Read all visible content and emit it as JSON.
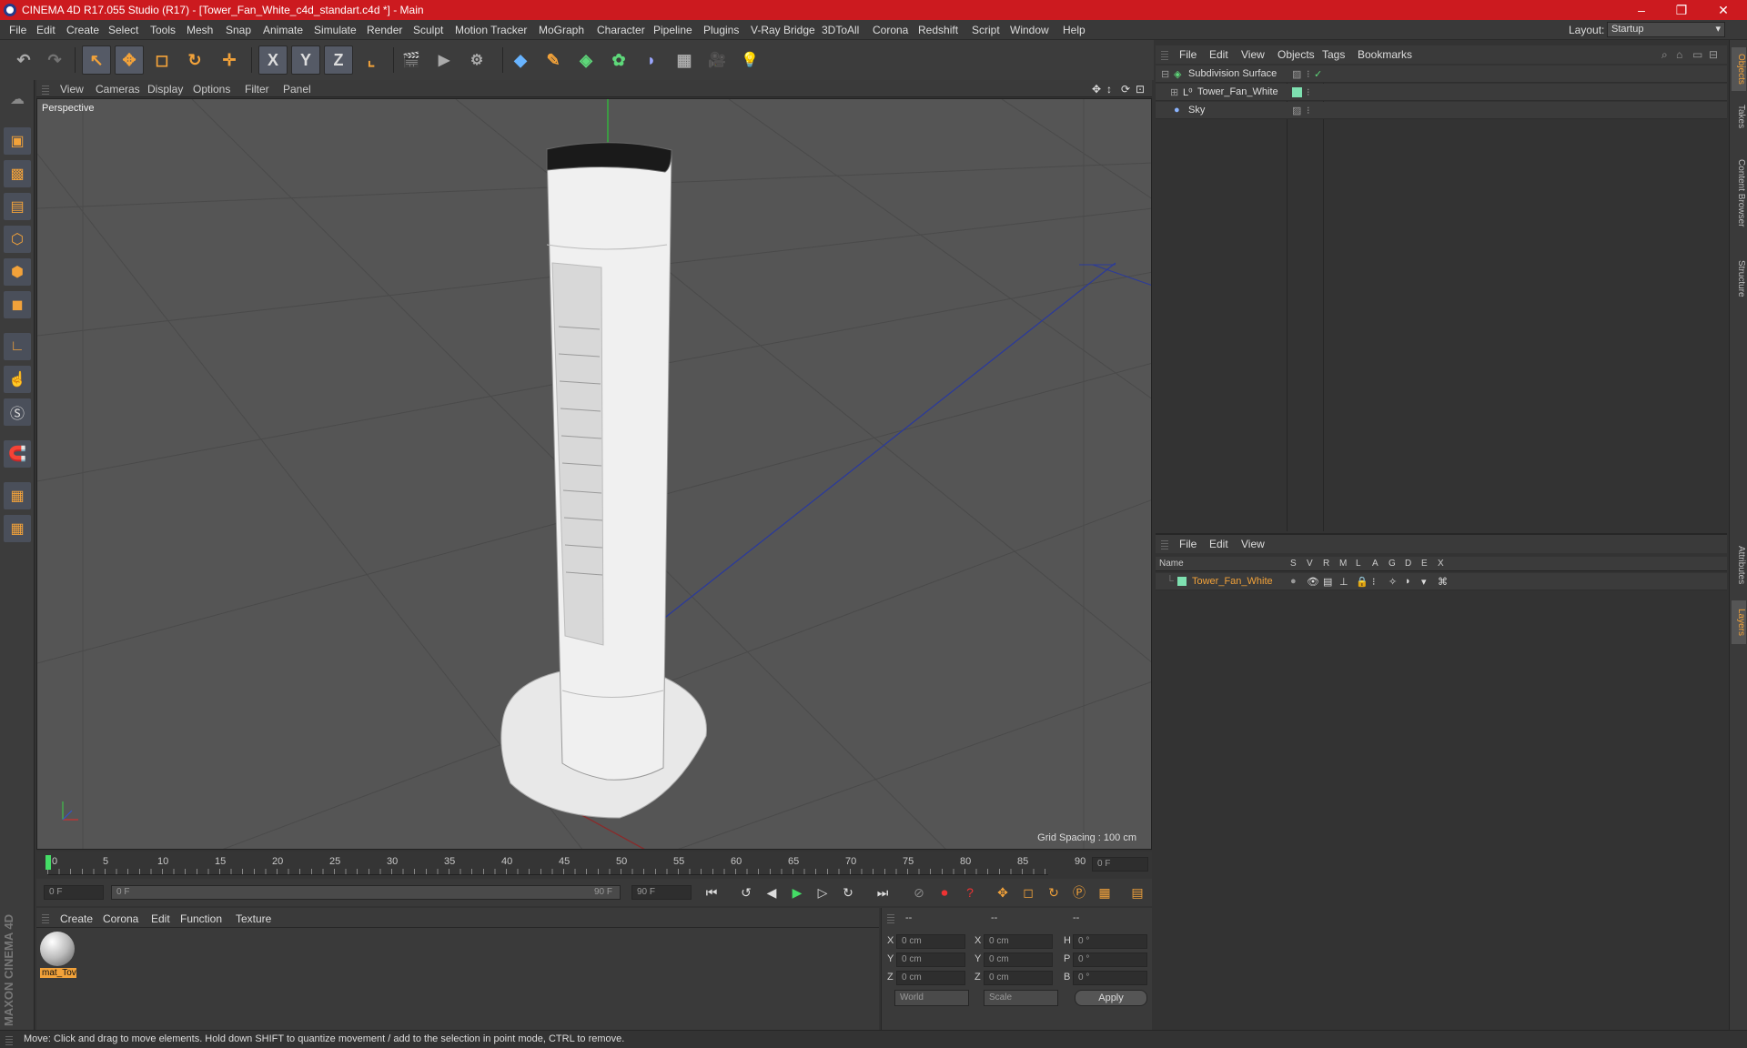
{
  "window": {
    "title": "CINEMA 4D R17.055 Studio (R17) - [Tower_Fan_White_c4d_standart.c4d *] - Main",
    "minimize": "–",
    "maximize": "❐",
    "close": "✕"
  },
  "menubar": {
    "items": [
      "File",
      "Edit",
      "Create",
      "Select",
      "Tools",
      "Mesh",
      "Snap",
      "Animate",
      "Simulate",
      "Render",
      "Sculpt",
      "Motion Tracker",
      "MoGraph",
      "Character",
      "Pipeline",
      "Plugins",
      "V-Ray Bridge",
      "3DToAll",
      "Corona",
      "Redshift",
      "Script",
      "Window",
      "Help"
    ],
    "layout_label": "Layout:",
    "layout_value": "Startup"
  },
  "toolbar": {
    "undo": "↶",
    "redo": "↷",
    "select": "↖",
    "move": "✥",
    "scale": "◻",
    "rotate": "↻",
    "last": "✛",
    "x_axis": "X",
    "y_axis": "Y",
    "z_axis": "Z",
    "coord": "⌞",
    "render_view": "🎬",
    "render": "▶",
    "render_settings": "⚙",
    "cube": "◆",
    "pen": "✎",
    "subdiv": "◈",
    "cloner": "✿",
    "deformer": "◗",
    "floor": "▦",
    "camera": "🎥",
    "light": "💡"
  },
  "viewport": {
    "menu": [
      "View",
      "Cameras",
      "Display",
      "Options",
      "Filter",
      "Panel"
    ],
    "label": "Perspective",
    "grid_spacing": "Grid Spacing : 100 cm"
  },
  "timeline": {
    "ticks": [
      "0",
      "5",
      "10",
      "15",
      "20",
      "25",
      "30",
      "35",
      "40",
      "45",
      "50",
      "55",
      "60",
      "65",
      "70",
      "75",
      "80",
      "85",
      "90"
    ],
    "current_frame": "0 F",
    "start_field": "0 F",
    "range_start": "0 F",
    "range_end": "90 F",
    "end_field": "90 F"
  },
  "material_panel": {
    "menu": [
      "Create",
      "Corona",
      "Edit",
      "Function",
      "Texture"
    ],
    "material_name": "mat_Tov"
  },
  "coordinates": {
    "header_pos": "--",
    "header_size": "--",
    "header_rot": "--",
    "x_pos": "0 cm",
    "y_pos": "0 cm",
    "z_pos": "0 cm",
    "x_size": "0 cm",
    "y_size": "0 cm",
    "z_size": "0 cm",
    "h_rot": "0 °",
    "p_rot": "0 °",
    "b_rot": "0 °",
    "labels": {
      "x": "X",
      "y": "Y",
      "z": "Z",
      "h": "H",
      "p": "P",
      "b": "B"
    },
    "space": "World",
    "mode": "Scale",
    "apply": "Apply"
  },
  "object_manager": {
    "menu": [
      "File",
      "Edit",
      "View",
      "Objects",
      "Tags",
      "Bookmarks"
    ],
    "objects": [
      {
        "name": "Subdivision Surface"
      },
      {
        "name": "Tower_Fan_White"
      },
      {
        "name": "Sky"
      }
    ]
  },
  "layer_manager": {
    "menu": [
      "File",
      "Edit",
      "View"
    ],
    "columns": [
      "Name",
      "S",
      "V",
      "R",
      "M",
      "L",
      "A",
      "G",
      "D",
      "E",
      "X"
    ],
    "layers": [
      {
        "name": "Tower_Fan_White"
      }
    ]
  },
  "right_tabs": [
    "Objects",
    "Takes",
    "Content Browser",
    "Structure",
    "Attributes",
    "Layers"
  ],
  "left_brand": "MAXON CINEMA 4D",
  "status": "Move: Click and drag to move elements. Hold down SHIFT to quantize movement / add to the selection in point mode, CTRL to remove.",
  "colors": {
    "title_bar": "#cc1a1f",
    "accent_orange": "#f2a23a",
    "layer_name": "#f2a23a",
    "layer_color": "#7ee0b0",
    "playhead": "#44dd66"
  }
}
